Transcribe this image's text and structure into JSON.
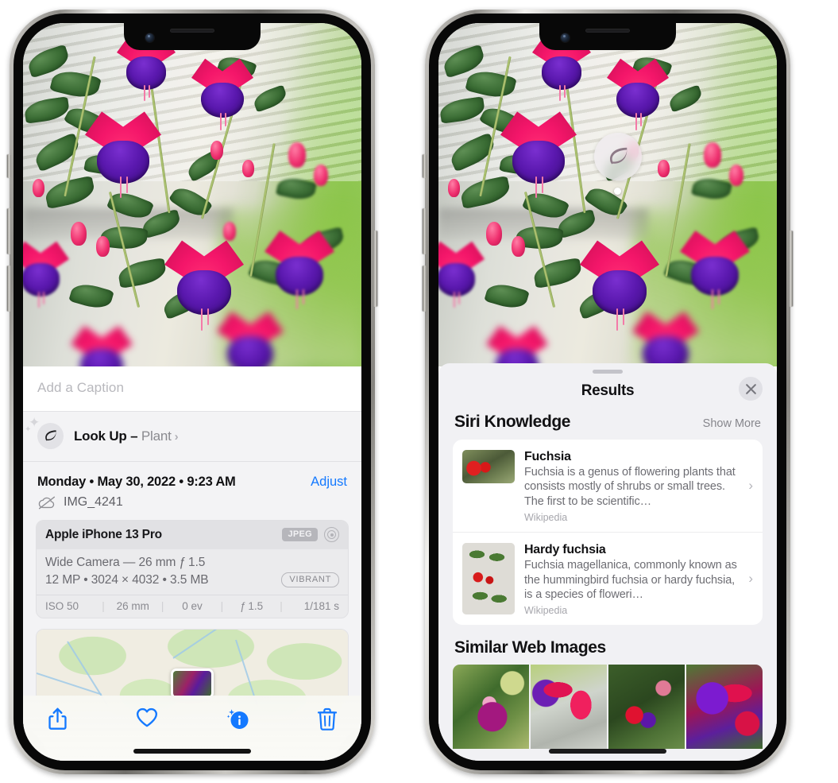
{
  "left_phone": {
    "caption": {
      "placeholder": "Add a Caption",
      "value": ""
    },
    "lookup": {
      "label": "Look Up",
      "dash": " – ",
      "subject": "Plant",
      "chevron": "›",
      "icon": "leaf-icon"
    },
    "metadata": {
      "date": "Monday • May 30, 2022 • 9:23 AM",
      "adjust_label": "Adjust",
      "filename": "IMG_4241",
      "cloud_icon": "cloud-slash-icon"
    },
    "exif": {
      "device": "Apple iPhone 13 Pro",
      "format_badge": "JPEG",
      "lens_icon": "aperture-icon",
      "lens_line": "Wide Camera — 26 mm ƒ 1.5",
      "specs_line": "12 MP • 3024 × 4032 • 3.5 MB",
      "style_badge": "VIBRANT",
      "footer": [
        "ISO 50",
        "26 mm",
        "0 ev",
        "ƒ 1.5",
        "1/181 s"
      ]
    },
    "toolbar": [
      {
        "name": "share-icon",
        "label": "Share"
      },
      {
        "name": "heart-icon",
        "label": "Favorite"
      },
      {
        "name": "info-sparkle-icon",
        "label": "Info"
      },
      {
        "name": "trash-icon",
        "label": "Delete"
      }
    ]
  },
  "right_phone": {
    "visual_lookup_badge": {
      "icon": "leaf-icon"
    },
    "sheet": {
      "title": "Results",
      "close_icon": "close-icon"
    },
    "siri_knowledge": {
      "heading": "Siri Knowledge",
      "show_more": "Show More",
      "items": [
        {
          "title": "Fuchsia",
          "description": "Fuchsia is a genus of flowering plants that consists mostly of shrubs or small trees. The first to be scientific…",
          "source": "Wikipedia",
          "chevron": "›"
        },
        {
          "title": "Hardy fuchsia",
          "description": "Fuchsia magellanica, commonly known as the hummingbird fuchsia or hardy fuchsia, is a species of floweri…",
          "source": "Wikipedia",
          "chevron": "›"
        }
      ]
    },
    "similar_web_images": {
      "heading": "Similar Web Images",
      "count": 4
    }
  },
  "colors": {
    "accent_blue": "#1479ff",
    "sheet_bg": "#f1f1f4",
    "card_bg": "#ffffff",
    "text_primary": "#111113",
    "text_secondary": "#6d6d73",
    "text_tertiary": "#a6a6ac"
  }
}
